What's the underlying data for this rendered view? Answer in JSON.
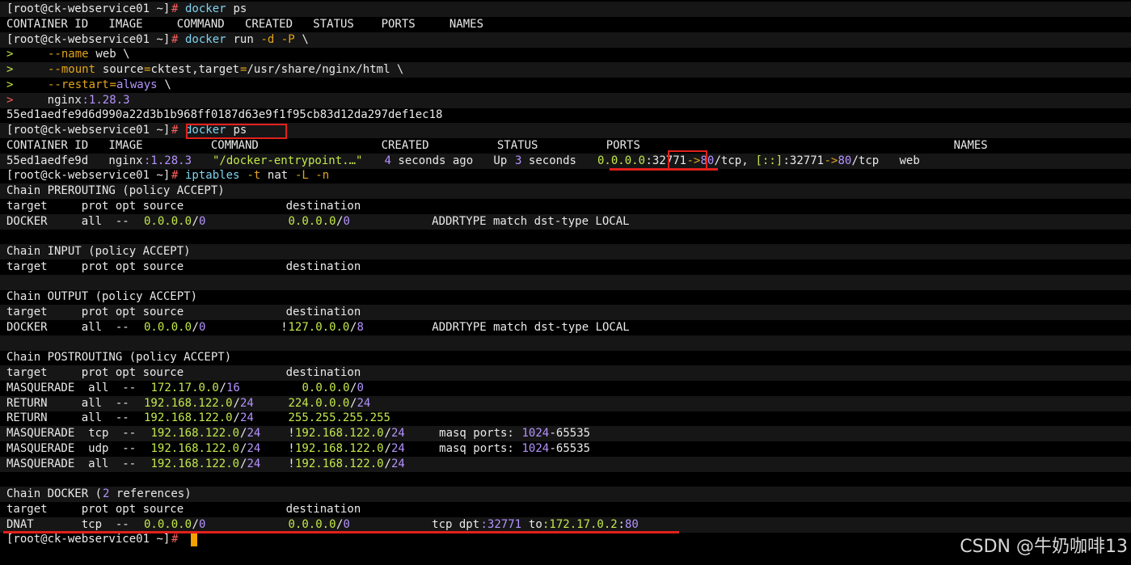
{
  "colors": {
    "background": "#000000",
    "band": "#161616",
    "text": "#e9e9e9",
    "cmd": "#7fd3f0",
    "prompt_hash": "#ff5d5d",
    "option": "#e2a41a",
    "value": "#b493ff",
    "ip": "#c3e84b",
    "highlight_box": "#e3201c",
    "cursor": "#f2a100"
  },
  "watermark": "CSDN @牛奶咖啡13",
  "lines": [
    {
      "segments": [
        {
          "text": "[root@ck-webservice01 ~]"
        },
        {
          "text": "# ",
          "color": "#ff5d5d"
        },
        {
          "text": "docker ",
          "color": "#7fd3f0"
        },
        {
          "text": "ps"
        }
      ]
    },
    {
      "segments": [
        {
          "text": "CONTAINER ID   IMAGE     COMMAND   CREATED   STATUS    PORTS     NAMES"
        }
      ]
    },
    {
      "segments": [
        {
          "text": "[root@ck-webservice01 ~]"
        },
        {
          "text": "# ",
          "color": "#ff5d5d"
        },
        {
          "text": "docker ",
          "color": "#7fd3f0"
        },
        {
          "text": "run "
        },
        {
          "text": "-d -P",
          "color": "#e2a41a"
        },
        {
          "text": " \\"
        }
      ]
    },
    {
      "segments": [
        {
          "text": ">",
          "color": "#c3e84b"
        },
        {
          "text": "     "
        },
        {
          "text": "--name",
          "color": "#e2a41a"
        },
        {
          "text": " web \\"
        }
      ]
    },
    {
      "segments": [
        {
          "text": ">",
          "color": "#c3e84b"
        },
        {
          "text": "     "
        },
        {
          "text": "--mount",
          "color": "#e2a41a"
        },
        {
          "text": " source"
        },
        {
          "text": "=",
          "color": "#e2a41a"
        },
        {
          "text": "cktest,target"
        },
        {
          "text": "=",
          "color": "#e2a41a"
        },
        {
          "text": "/usr/share/nginx/html \\"
        }
      ]
    },
    {
      "segments": [
        {
          "text": ">",
          "color": "#c3e84b"
        },
        {
          "text": "     "
        },
        {
          "text": "--restart",
          "color": "#e2a41a"
        },
        {
          "text": "=",
          "color": "#e2a41a"
        },
        {
          "text": "always",
          "color": "#b493ff"
        },
        {
          "text": " \\"
        }
      ]
    },
    {
      "segments": [
        {
          "text": ">",
          "color": "#ff5d5d"
        },
        {
          "text": "     nginx"
        },
        {
          "text": ":1.28.3",
          "color": "#b493ff"
        }
      ]
    },
    {
      "segments": [
        {
          "text": "55ed1aedfe9d6d990a22d3b1b968ff0187d63e9f1f95cb83d12da297def1ec18"
        }
      ]
    },
    {
      "segments": [
        {
          "text": "[root@ck-webservice01 ~]"
        },
        {
          "text": "# ",
          "color": "#ff5d5d"
        },
        {
          "text": "docker ",
          "color": "#7fd3f0"
        },
        {
          "text": "ps"
        }
      ]
    },
    {
      "segments": [
        {
          "text": "CONTAINER ID   IMAGE          COMMAND                  CREATED          STATUS          PORTS                                              NAMES"
        }
      ]
    },
    {
      "segments": [
        {
          "text": "55ed1aedfe9d   nginx"
        },
        {
          "text": ":1.28.3",
          "color": "#b493ff"
        },
        {
          "text": "   "
        },
        {
          "text": "\"/docker-entrypoint.…\"",
          "color": "#c3e84b"
        },
        {
          "text": "   "
        },
        {
          "text": "4",
          "color": "#b493ff"
        },
        {
          "text": " seconds ago   Up "
        },
        {
          "text": "3",
          "color": "#b493ff"
        },
        {
          "text": " seconds   "
        },
        {
          "text": "0.0.0.0",
          "color": "#c3e84b"
        },
        {
          "text": ":32771"
        },
        {
          "text": "->",
          "color": "#e2a41a"
        },
        {
          "text": "80",
          "color": "#b493ff"
        },
        {
          "text": "/tcp, "
        },
        {
          "text": "[::]",
          "color": "#c3e84b"
        },
        {
          "text": ":32771"
        },
        {
          "text": "->",
          "color": "#e2a41a"
        },
        {
          "text": "80",
          "color": "#b493ff"
        },
        {
          "text": "/tcp   web"
        }
      ]
    },
    {
      "segments": [
        {
          "text": "[root@ck-webservice01 ~]"
        },
        {
          "text": "# ",
          "color": "#ff5d5d"
        },
        {
          "text": "iptables ",
          "color": "#7fd3f0"
        },
        {
          "text": "-t",
          "color": "#e2a41a"
        },
        {
          "text": " nat "
        },
        {
          "text": "-L -n",
          "color": "#e2a41a"
        }
      ]
    },
    {
      "segments": [
        {
          "text": "Chain PREROUTING (policy ACCEPT)"
        }
      ]
    },
    {
      "segments": [
        {
          "text": "target     prot opt source               destination"
        }
      ]
    },
    {
      "segments": [
        {
          "text": "DOCKER     all  --  "
        },
        {
          "text": "0.0.0.0",
          "color": "#c3e84b"
        },
        {
          "text": "/"
        },
        {
          "text": "0",
          "color": "#b493ff"
        },
        {
          "text": "            "
        },
        {
          "text": "0.0.0.0",
          "color": "#c3e84b"
        },
        {
          "text": "/"
        },
        {
          "text": "0",
          "color": "#b493ff"
        },
        {
          "text": "            ADDRTYPE match dst-type LOCAL"
        }
      ]
    },
    {
      "segments": []
    },
    {
      "segments": [
        {
          "text": "Chain INPUT (policy ACCEPT)"
        }
      ]
    },
    {
      "segments": [
        {
          "text": "target     prot opt source               destination"
        }
      ]
    },
    {
      "segments": []
    },
    {
      "segments": [
        {
          "text": "Chain OUTPUT (policy ACCEPT)"
        }
      ]
    },
    {
      "segments": [
        {
          "text": "target     prot opt source               destination"
        }
      ]
    },
    {
      "segments": [
        {
          "text": "DOCKER     all  --  "
        },
        {
          "text": "0.0.0.0",
          "color": "#c3e84b"
        },
        {
          "text": "/"
        },
        {
          "text": "0",
          "color": "#b493ff"
        },
        {
          "text": "           !"
        },
        {
          "text": "127.0.0.0",
          "color": "#c3e84b"
        },
        {
          "text": "/"
        },
        {
          "text": "8",
          "color": "#b493ff"
        },
        {
          "text": "          ADDRTYPE match dst-type LOCAL"
        }
      ]
    },
    {
      "segments": []
    },
    {
      "segments": [
        {
          "text": "Chain POSTROUTING (policy ACCEPT)"
        }
      ]
    },
    {
      "segments": [
        {
          "text": "target     prot opt source               destination"
        }
      ]
    },
    {
      "segments": [
        {
          "text": "MASQUERADE  all  --  "
        },
        {
          "text": "172.17.0.0",
          "color": "#c3e84b"
        },
        {
          "text": "/"
        },
        {
          "text": "16",
          "color": "#b493ff"
        },
        {
          "text": "         "
        },
        {
          "text": "0.0.0.0",
          "color": "#c3e84b"
        },
        {
          "text": "/"
        },
        {
          "text": "0",
          "color": "#b493ff"
        }
      ]
    },
    {
      "segments": [
        {
          "text": "RETURN     all  --  "
        },
        {
          "text": "192.168.122.0",
          "color": "#c3e84b"
        },
        {
          "text": "/"
        },
        {
          "text": "24",
          "color": "#b493ff"
        },
        {
          "text": "     "
        },
        {
          "text": "224.0.0.0",
          "color": "#c3e84b"
        },
        {
          "text": "/"
        },
        {
          "text": "24",
          "color": "#b493ff"
        }
      ]
    },
    {
      "segments": [
        {
          "text": "RETURN     all  --  "
        },
        {
          "text": "192.168.122.0",
          "color": "#c3e84b"
        },
        {
          "text": "/"
        },
        {
          "text": "24",
          "color": "#b493ff"
        },
        {
          "text": "     "
        },
        {
          "text": "255.255.255.255",
          "color": "#c3e84b"
        }
      ]
    },
    {
      "segments": [
        {
          "text": "MASQUERADE  tcp  --  "
        },
        {
          "text": "192.168.122.0",
          "color": "#c3e84b"
        },
        {
          "text": "/"
        },
        {
          "text": "24",
          "color": "#b493ff"
        },
        {
          "text": "    !"
        },
        {
          "text": "192.168.122.0",
          "color": "#c3e84b"
        },
        {
          "text": "/"
        },
        {
          "text": "24",
          "color": "#b493ff"
        },
        {
          "text": "     masq ports: "
        },
        {
          "text": "1024",
          "color": "#b493ff"
        },
        {
          "text": "-65535"
        }
      ]
    },
    {
      "segments": [
        {
          "text": "MASQUERADE  udp  --  "
        },
        {
          "text": "192.168.122.0",
          "color": "#c3e84b"
        },
        {
          "text": "/"
        },
        {
          "text": "24",
          "color": "#b493ff"
        },
        {
          "text": "    !"
        },
        {
          "text": "192.168.122.0",
          "color": "#c3e84b"
        },
        {
          "text": "/"
        },
        {
          "text": "24",
          "color": "#b493ff"
        },
        {
          "text": "     masq ports: "
        },
        {
          "text": "1024",
          "color": "#b493ff"
        },
        {
          "text": "-65535"
        }
      ]
    },
    {
      "segments": [
        {
          "text": "MASQUERADE  all  --  "
        },
        {
          "text": "192.168.122.0",
          "color": "#c3e84b"
        },
        {
          "text": "/"
        },
        {
          "text": "24",
          "color": "#b493ff"
        },
        {
          "text": "    !"
        },
        {
          "text": "192.168.122.0",
          "color": "#c3e84b"
        },
        {
          "text": "/"
        },
        {
          "text": "24",
          "color": "#b493ff"
        }
      ]
    },
    {
      "segments": []
    },
    {
      "segments": [
        {
          "text": "Chain DOCKER ("
        },
        {
          "text": "2",
          "color": "#b493ff"
        },
        {
          "text": " references)"
        }
      ]
    },
    {
      "segments": [
        {
          "text": "target     prot opt source               destination"
        }
      ]
    },
    {
      "segments": [
        {
          "text": "DNAT       tcp  --  "
        },
        {
          "text": "0.0.0.0",
          "color": "#c3e84b"
        },
        {
          "text": "/"
        },
        {
          "text": "0",
          "color": "#b493ff"
        },
        {
          "text": "            "
        },
        {
          "text": "0.0.0.0",
          "color": "#c3e84b"
        },
        {
          "text": "/"
        },
        {
          "text": "0",
          "color": "#b493ff"
        },
        {
          "text": "            tcp dpt"
        },
        {
          "text": ":32771",
          "color": "#b493ff"
        },
        {
          "text": " to"
        },
        {
          "text": ":172.17.0.2",
          "color": "#c3e84b"
        },
        {
          "text": ":"
        },
        {
          "text": "80",
          "color": "#b493ff"
        }
      ]
    },
    {
      "segments": [
        {
          "text": "[root@ck-webservice01 ~]"
        },
        {
          "text": "# ",
          "color": "#ff5d5d"
        }
      ]
    }
  ]
}
